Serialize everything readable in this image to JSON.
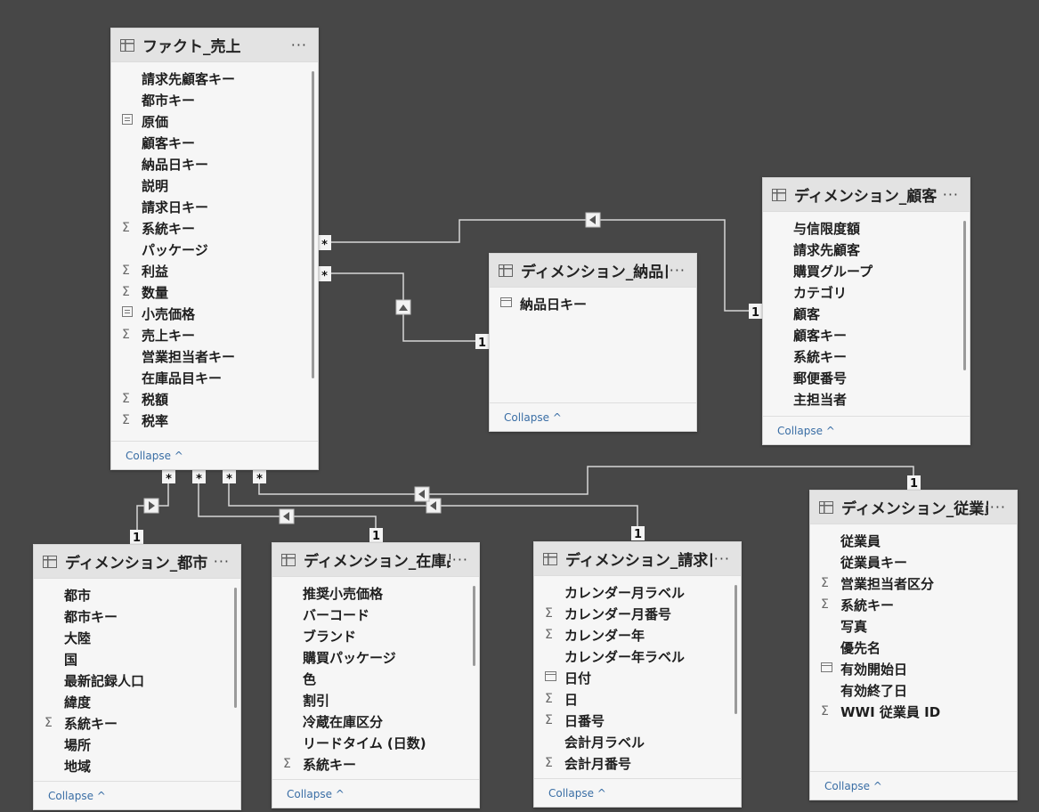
{
  "common": {
    "more_label": "···",
    "collapse_label": "Collapse ^"
  },
  "relationship_labels": {
    "many": "*",
    "one": "1"
  },
  "tables": {
    "fact_sales": {
      "title": "ファクト_売上",
      "fields": [
        {
          "icon": "",
          "label": "請求先顧客キー"
        },
        {
          "icon": "",
          "label": "都市キー"
        },
        {
          "icon": "measure-icon",
          "label": "原価"
        },
        {
          "icon": "",
          "label": "顧客キー"
        },
        {
          "icon": "",
          "label": "納品日キー"
        },
        {
          "icon": "",
          "label": "説明"
        },
        {
          "icon": "",
          "label": "請求日キー"
        },
        {
          "icon": "sigma",
          "label": "系統キー"
        },
        {
          "icon": "",
          "label": "パッケージ"
        },
        {
          "icon": "sigma",
          "label": "利益"
        },
        {
          "icon": "sigma",
          "label": "数量"
        },
        {
          "icon": "measure-icon",
          "label": "小売価格"
        },
        {
          "icon": "sigma",
          "label": "売上キー"
        },
        {
          "icon": "",
          "label": "営業担当者キー"
        },
        {
          "icon": "",
          "label": "在庫品目キー"
        },
        {
          "icon": "sigma",
          "label": "税額"
        },
        {
          "icon": "sigma",
          "label": "税率"
        }
      ]
    },
    "dim_delivery_date": {
      "title": "ディメンション_納品日",
      "fields": [
        {
          "icon": "calendar-icon",
          "label": "納品日キー"
        }
      ]
    },
    "dim_customer": {
      "title": "ディメンション_顧客",
      "fields": [
        {
          "icon": "",
          "label": "与信限度額"
        },
        {
          "icon": "",
          "label": "請求先顧客"
        },
        {
          "icon": "",
          "label": "購買グループ"
        },
        {
          "icon": "",
          "label": "カテゴリ"
        },
        {
          "icon": "",
          "label": "顧客"
        },
        {
          "icon": "",
          "label": "顧客キー"
        },
        {
          "icon": "",
          "label": "系統キー"
        },
        {
          "icon": "",
          "label": "郵便番号"
        },
        {
          "icon": "",
          "label": "主担当者"
        }
      ]
    },
    "dim_city": {
      "title": "ディメンション_都市",
      "fields": [
        {
          "icon": "",
          "label": "都市"
        },
        {
          "icon": "",
          "label": "都市キー"
        },
        {
          "icon": "",
          "label": "大陸"
        },
        {
          "icon": "",
          "label": "国"
        },
        {
          "icon": "",
          "label": "最新記録人口"
        },
        {
          "icon": "",
          "label": "緯度"
        },
        {
          "icon": "sigma",
          "label": "系統キー"
        },
        {
          "icon": "",
          "label": "場所"
        },
        {
          "icon": "",
          "label": "地域"
        }
      ]
    },
    "dim_stock_item": {
      "title": "ディメンション_在庫品",
      "fields": [
        {
          "icon": "",
          "label": "推奨小売価格"
        },
        {
          "icon": "",
          "label": "バーコード"
        },
        {
          "icon": "",
          "label": "ブランド"
        },
        {
          "icon": "",
          "label": "購買パッケージ"
        },
        {
          "icon": "",
          "label": "色"
        },
        {
          "icon": "",
          "label": "割引"
        },
        {
          "icon": "",
          "label": "冷蔵在庫区分"
        },
        {
          "icon": "",
          "label": "リードタイム (日数)"
        },
        {
          "icon": "sigma",
          "label": "系統キー"
        }
      ]
    },
    "dim_invoice_date": {
      "title": "ディメンション_請求日",
      "fields": [
        {
          "icon": "",
          "label": "カレンダー月ラベル"
        },
        {
          "icon": "sigma",
          "label": "カレンダー月番号"
        },
        {
          "icon": "sigma",
          "label": "カレンダー年"
        },
        {
          "icon": "",
          "label": "カレンダー年ラベル"
        },
        {
          "icon": "calendar-icon",
          "label": "日付"
        },
        {
          "icon": "sigma",
          "label": "日"
        },
        {
          "icon": "sigma",
          "label": "日番号"
        },
        {
          "icon": "",
          "label": "会計月ラベル"
        },
        {
          "icon": "sigma",
          "label": "会計月番号"
        }
      ]
    },
    "dim_employee": {
      "title": "ディメンション_従業員",
      "fields": [
        {
          "icon": "",
          "label": "従業員"
        },
        {
          "icon": "",
          "label": "従業員キー"
        },
        {
          "icon": "sigma",
          "label": "営業担当者区分"
        },
        {
          "icon": "sigma",
          "label": "系統キー"
        },
        {
          "icon": "",
          "label": "写真"
        },
        {
          "icon": "",
          "label": "優先名"
        },
        {
          "icon": "calendar-icon",
          "label": "有効開始日"
        },
        {
          "icon": "",
          "label": "有効終了日"
        },
        {
          "icon": "sigma",
          "label": "WWI 従業員 ID"
        }
      ]
    }
  }
}
